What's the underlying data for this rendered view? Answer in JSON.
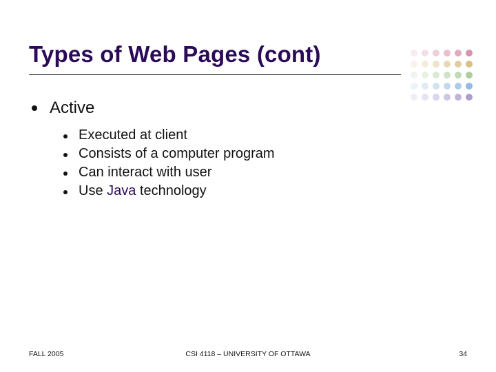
{
  "title": "Types of Web Pages (cont)",
  "level1": {
    "text": "Active"
  },
  "level2": [
    {
      "text": "Executed at client"
    },
    {
      "text_pre": "Consists of a computer program"
    },
    {
      "text_pre": "Can interact with user"
    },
    {
      "text_pre": "Use ",
      "java": "Java",
      "text_post": " technology"
    }
  ],
  "footer": {
    "left": "FALL 2005",
    "center": "CSI 4118 – UNIVERSITY OF OTTAWA",
    "right": "34"
  }
}
